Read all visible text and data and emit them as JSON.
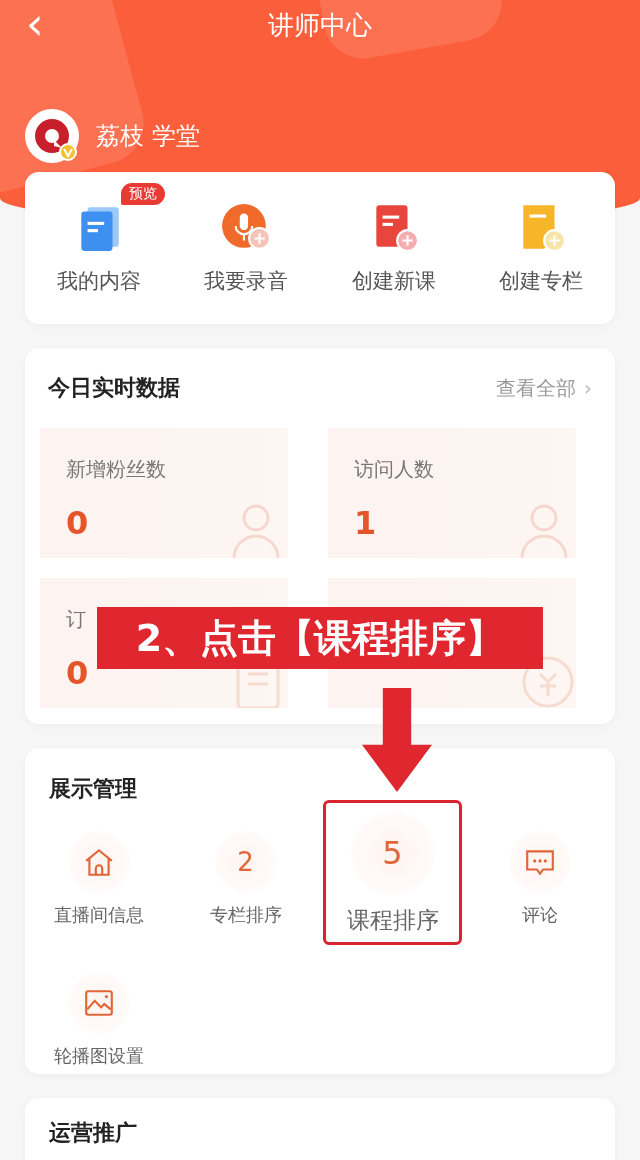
{
  "header": {
    "back": "‹",
    "title": "讲师中心"
  },
  "profile": {
    "name": "荔枝 学堂",
    "verified": true
  },
  "quick_actions": [
    {
      "kind": "content",
      "label": "我的内容",
      "badge": "预览"
    },
    {
      "kind": "record",
      "label": "我要录音"
    },
    {
      "kind": "course",
      "label": "创建新课"
    },
    {
      "kind": "column",
      "label": "创建专栏"
    }
  ],
  "stats": {
    "title": "今日实时数据",
    "link": "查看全部",
    "link_arrow": "›",
    "tiles": [
      {
        "kind": "fans",
        "label": "新增粉丝数",
        "value": "0"
      },
      {
        "kind": "visitors",
        "label": "访问人数",
        "value": "1"
      },
      {
        "kind": "orders",
        "label": "订",
        "value": "0"
      },
      {
        "kind": "income"
      }
    ]
  },
  "display": {
    "title": "展示管理",
    "items": [
      {
        "kind": "home",
        "label": "直播间信息",
        "highlighted": false
      },
      {
        "kind": "number",
        "number": "2",
        "label": "专栏排序",
        "highlighted": false
      },
      {
        "kind": "number",
        "number": "5",
        "label": "课程排序",
        "highlighted": true
      },
      {
        "kind": "comment",
        "label": "评论",
        "highlighted": false
      },
      {
        "kind": "image",
        "label": "轮播图设置",
        "highlighted": false
      }
    ]
  },
  "promotion": {
    "title": "运营推广"
  },
  "annotation": {
    "text": "2、点击【课程排序】"
  }
}
